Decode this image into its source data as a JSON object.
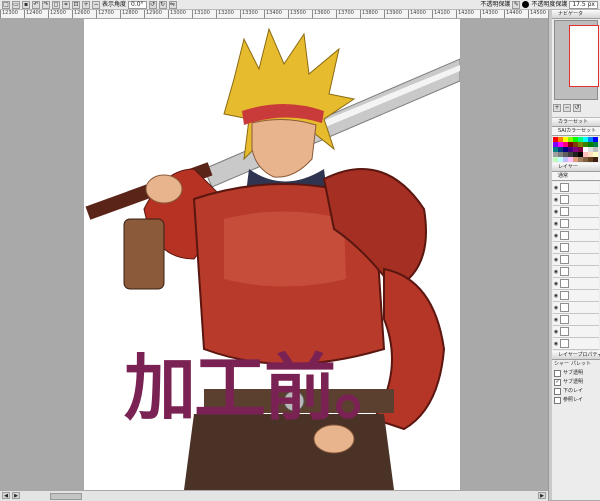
{
  "toolbar": {
    "buttons": [
      "new-file",
      "open-file",
      "save",
      "undo",
      "redo",
      "deselect",
      "crop",
      "fit"
    ],
    "rotation_label": "表示角度",
    "rotation_value": "0.0°",
    "opacity_label": "不透明度保護",
    "layer_mode_label": "不透明保護",
    "brush_size": "17.5 px"
  },
  "ruler": {
    "ticks": [
      "12300",
      "12400",
      "12500",
      "12600",
      "12700",
      "12800",
      "12900",
      "13000",
      "13100",
      "13200",
      "13300",
      "13400",
      "13500",
      "13600",
      "13700",
      "13800",
      "13900",
      "14000",
      "14100",
      "14200",
      "14300",
      "14400",
      "14500"
    ]
  },
  "artwork": {
    "caption": "加工前。"
  },
  "panel": {
    "navigator_title": "ナビゲータ",
    "color_title": "カラーセット",
    "color_set_name": "SAIカラーセット",
    "layer_title": "レイヤー",
    "layer_mode": "通常",
    "layer_props_title": "レイヤープロパティ",
    "palette_label": "パレット",
    "clip_label": "シャー",
    "options": [
      {
        "label": "サブ透明",
        "checked": false
      },
      {
        "label": "サブ透明",
        "checked": true
      },
      {
        "label": "下のレイ",
        "checked": false
      },
      {
        "label": "参照レイ",
        "checked": false
      }
    ],
    "swatch_colors": [
      "#ff0000",
      "#ff8000",
      "#ffff00",
      "#80ff00",
      "#00ff00",
      "#00ff80",
      "#00ffff",
      "#0080ff",
      "#0000ff",
      "#8000ff",
      "#ff00ff",
      "#ff0080",
      "#800000",
      "#804000",
      "#808000",
      "#408000",
      "#008000",
      "#008040",
      "#008080",
      "#004080",
      "#000080",
      "#400080",
      "#800080",
      "#800040",
      "#ffffff",
      "#e0e0e0",
      "#c0c0c0",
      "#a0a0a0",
      "#808080",
      "#606060",
      "#404040",
      "#202020",
      "#000000",
      "#ffc0c0",
      "#ffe0c0",
      "#ffffc0",
      "#c0ffc0",
      "#c0ffff",
      "#c0c0ff",
      "#ffc0ff",
      "#e0a080",
      "#a08060",
      "#806040",
      "#604020",
      "#402010"
    ],
    "layer_count": 14
  },
  "colors": {
    "caption": "#7a2253",
    "canvas_bg": "#a9a9a9",
    "accent_red": "#e23030"
  }
}
